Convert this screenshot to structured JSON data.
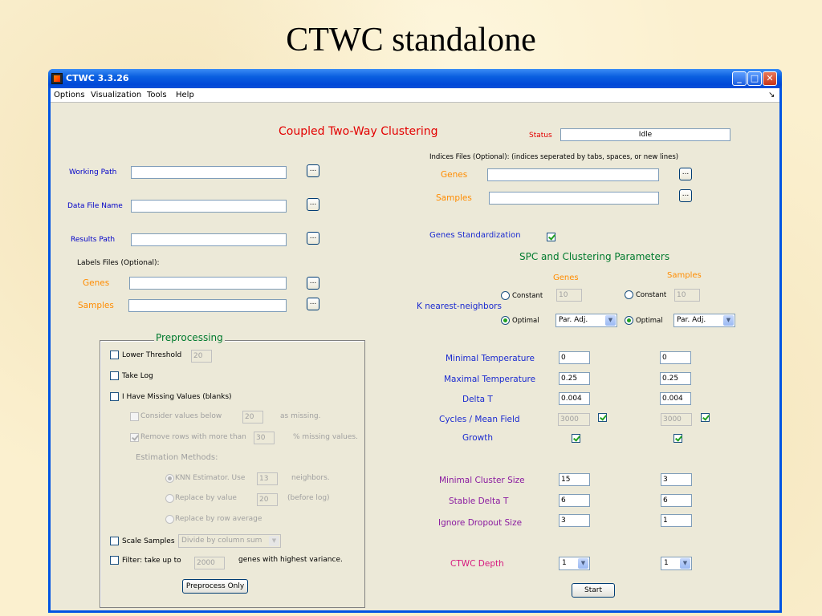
{
  "slide": {
    "title": "CTWC standalone"
  },
  "window": {
    "title": "CTWC 3.3.26",
    "min": "_",
    "max": "□",
    "close": "✕"
  },
  "menu": {
    "items": [
      "Options",
      "Visualization",
      "Tools",
      "Help"
    ],
    "arrow": "↘"
  },
  "header": {
    "app_title": "Coupled Two-Way Clustering",
    "status_label": "Status",
    "status_value": "Idle"
  },
  "paths": {
    "working_path": "Working Path",
    "data_file_name": "Data File Name",
    "results_path": "Results Path",
    "labels_files": "Labels Files (Optional):",
    "genes": "Genes",
    "samples": "Samples",
    "browse": "..."
  },
  "indices": {
    "note": "Indices Files (Optional): (indices seperated by tabs, spaces, or new lines)",
    "genes": "Genes",
    "samples": "Samples"
  },
  "genes_standardization": "Genes Standardization",
  "spc": {
    "title": "SPC and Clustering Parameters",
    "col_genes": "Genes",
    "col_samples": "Samples",
    "knn_label": "K nearest-neighbors",
    "constant": "Constant",
    "optimal": "Optimal",
    "genes_knn": "10",
    "samples_knn": "10",
    "genes_method": "Par. Adj.",
    "samples_method": "Par. Adj.",
    "rows": [
      {
        "label": "Minimal Temperature",
        "genes": "0",
        "samples": "0"
      },
      {
        "label": "Maximal Temperature",
        "genes": "0.25",
        "samples": "0.25"
      },
      {
        "label": "Delta T",
        "genes": "0.004",
        "samples": "0.004"
      },
      {
        "label": "Cycles / Mean Field",
        "genes": "3000",
        "samples": "3000"
      },
      {
        "label": "Growth"
      }
    ],
    "rows2": [
      {
        "label": "Minimal Cluster Size",
        "genes": "15",
        "samples": "3"
      },
      {
        "label": "Stable Delta T",
        "genes": "6",
        "samples": "6"
      },
      {
        "label": "Ignore Dropout Size",
        "genes": "3",
        "samples": "1"
      }
    ],
    "depth_label": "CTWC Depth",
    "genes_depth": "1",
    "samples_depth": "1",
    "start": "Start"
  },
  "preprocessing": {
    "title": "Preprocessing",
    "lower_threshold": "Lower Threshold",
    "lower_threshold_value": "20",
    "take_log": "Take Log",
    "missing": "I Have Missing Values (blanks)",
    "consider_below": "Consider values below",
    "consider_value": "20",
    "as_missing": "as missing.",
    "remove_rows": "Remove rows with more than",
    "remove_value": "30",
    "pct_missing": "% missing values.",
    "estimation": "Estimation Methods:",
    "knn_est": "KNN Estimator.  Use",
    "knn_value": "13",
    "neighbors": "neighbors.",
    "replace_value": "Replace by value",
    "replace_value_num": "20",
    "before_log": "(before log)",
    "replace_row_avg": "Replace by row average",
    "scale_samples": "Scale Samples",
    "scale_method": "Divide by column sum",
    "filter": "Filter: take up to",
    "filter_value": "2000",
    "filter_suffix": "genes with highest variance.",
    "preprocess_only": "Preprocess Only"
  },
  "colors": {
    "window_blue": "#0054e3",
    "face": "#ece9d8",
    "title_red": "#e30000",
    "label_blue": "#1a2ad0",
    "label_purple": "#8a1aa0",
    "label_orange": "#ff8c00",
    "group_green": "#007a2e"
  }
}
